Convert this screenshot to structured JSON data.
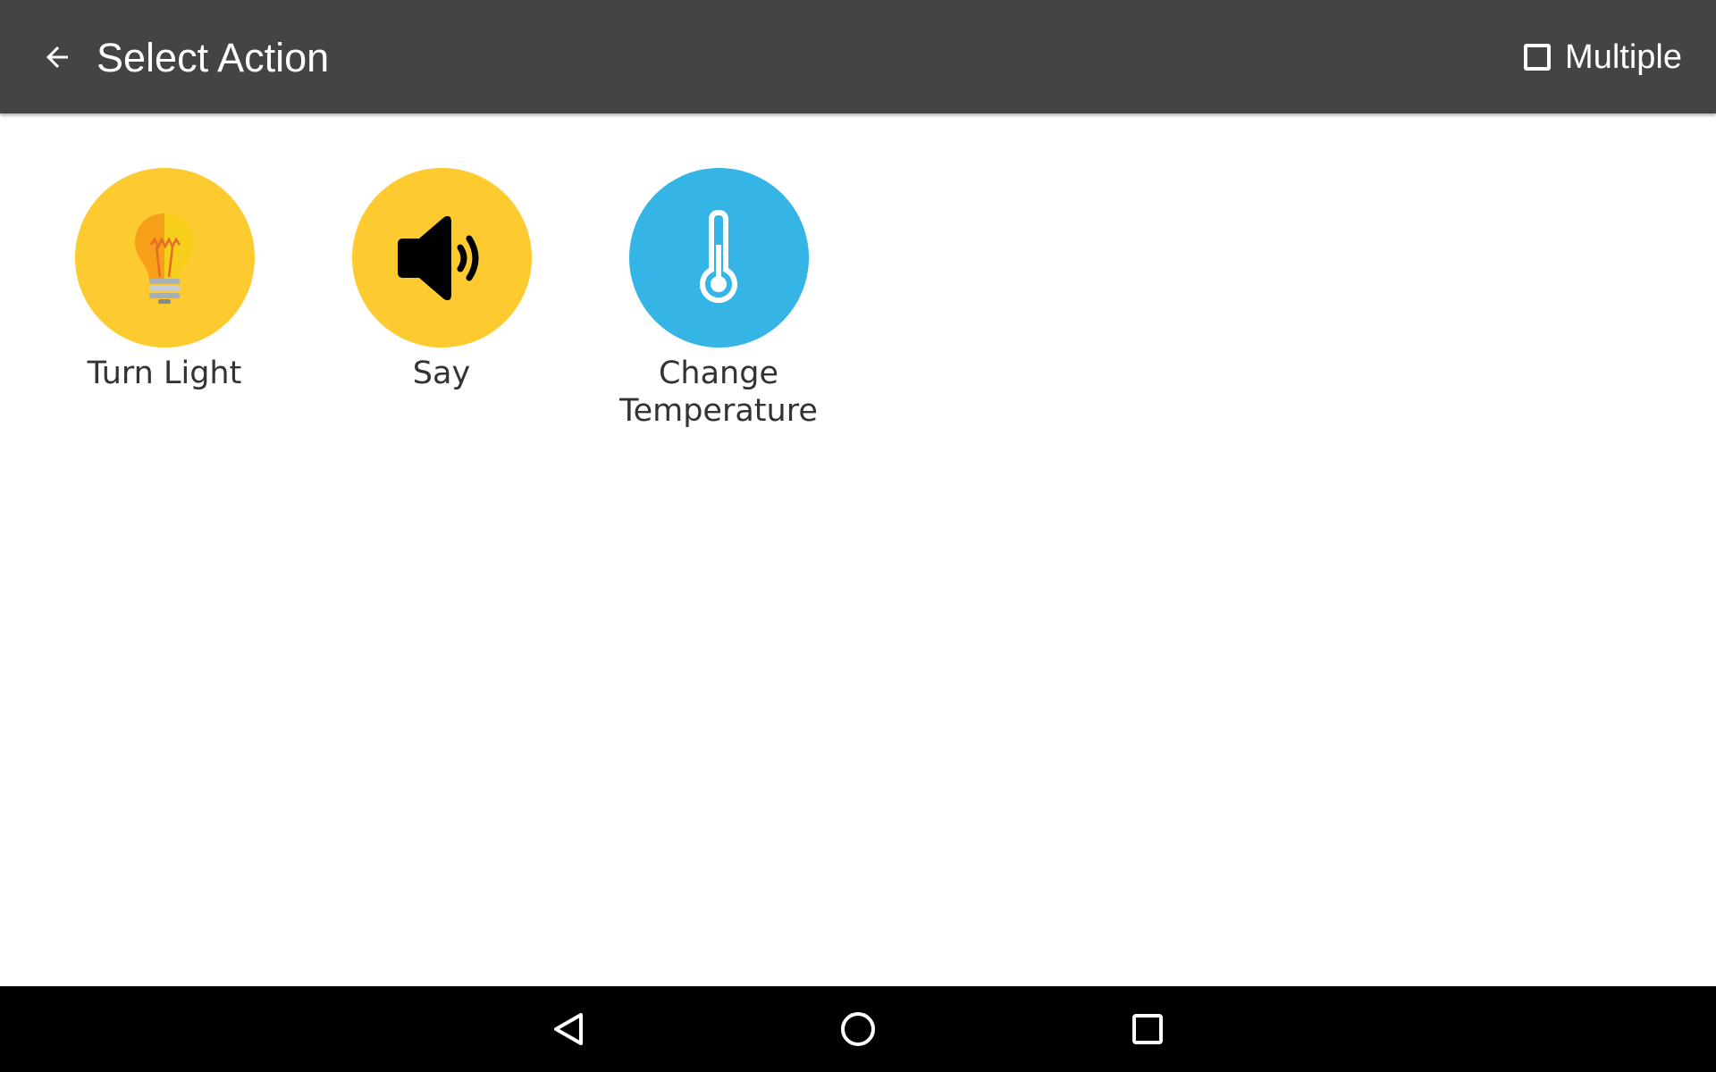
{
  "toolbar": {
    "title": "Select Action",
    "back_icon": "arrow-back-icon",
    "multiple_label": "Multiple",
    "multiple_checked": false
  },
  "actions": [
    {
      "label": "Turn Light",
      "icon": "light-bulb-icon",
      "color": "#FDCA2F"
    },
    {
      "label": "Say",
      "icon": "speaker-icon",
      "color": "#FDCA2F"
    },
    {
      "label": "Change\nTemperature",
      "icon": "thermometer-icon",
      "color": "#35B5E5"
    }
  ],
  "navbar": {
    "back_icon": "nav-back-icon",
    "home_icon": "nav-home-icon",
    "recents_icon": "nav-recents-icon"
  },
  "colors": {
    "toolbar_bg": "#444444",
    "navbar_bg": "#000000",
    "label_text": "#333333"
  }
}
